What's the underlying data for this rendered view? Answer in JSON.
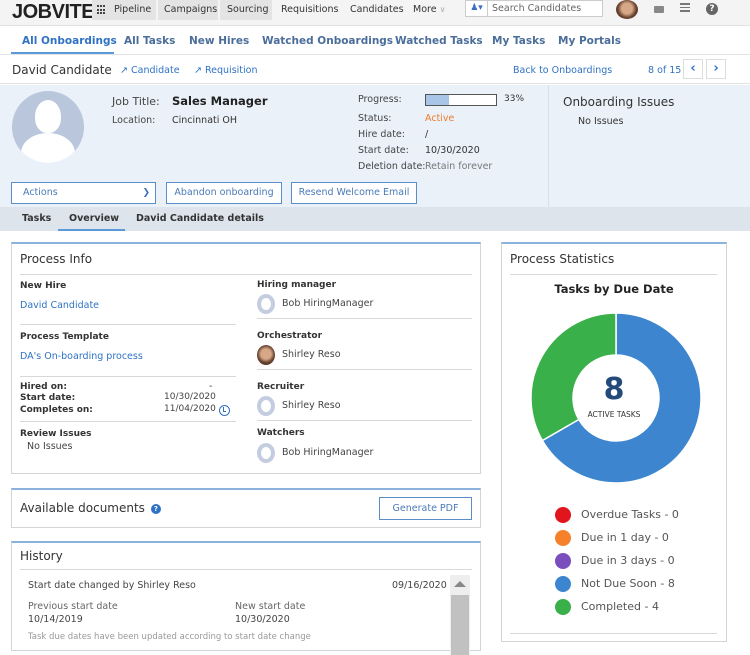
{
  "topbar": {
    "logo": "JOBVITE",
    "nav": [
      "Pipeline",
      "Campaigns",
      "Sourcing",
      "Requisitions",
      "Candidates",
      "More"
    ],
    "search_placeholder": "Search Candidates"
  },
  "subnav": {
    "items": [
      "All Onboardings",
      "All Tasks",
      "New Hires",
      "Watched Onboardings",
      "Watched Tasks",
      "My Tasks",
      "My Portals"
    ],
    "active": "All Onboardings"
  },
  "candidate_bar": {
    "name": "David Candidate",
    "candidate_link": "Candidate",
    "requisition_link": "Requisition",
    "back_link": "Back to Onboardings",
    "pager": "8 of 15"
  },
  "hero": {
    "job_title_label": "Job Title:",
    "job_title": "Sales Manager",
    "location_label": "Location:",
    "location": "Cincinnati OH",
    "progress_label": "Progress:",
    "progress_percent": 33,
    "progress_text": "33%",
    "status_label": "Status:",
    "status": "Active",
    "hire_date_label": "Hire date:",
    "hire_date": "/",
    "start_date_label": "Start date:",
    "start_date": "10/30/2020",
    "deletion_date_label": "Deletion date:",
    "deletion_date": "Retain forever",
    "issues_title": "Onboarding Issues",
    "issues_value": "No Issues",
    "actions_label": "Actions",
    "abandon_label": "Abandon onboarding",
    "resend_label": "Resend Welcome Email"
  },
  "tabs": {
    "items": [
      "Tasks",
      "Overview",
      "David Candidate details"
    ],
    "active": "Overview"
  },
  "process_info": {
    "title": "Process Info",
    "new_hire_label": "New Hire",
    "new_hire": "David Candidate",
    "template_label": "Process Template",
    "template": "DA's On-boarding process",
    "hired_on_label": "Hired on:",
    "hired_on": "-",
    "start_date_label": "Start date:",
    "start_date": "10/30/2020",
    "completes_on_label": "Completes on:",
    "completes_on": "11/04/2020",
    "review_issues_label": "Review Issues",
    "review_issues": "No Issues",
    "hiring_manager_label": "Hiring manager",
    "hiring_manager": "Bob HiringManager",
    "orchestrator_label": "Orchestrator",
    "orchestrator": "Shirley Reso",
    "recruiter_label": "Recruiter",
    "recruiter": "Shirley Reso",
    "watchers_label": "Watchers",
    "watchers": "Bob HiringManager"
  },
  "documents": {
    "title": "Available documents",
    "generate_label": "Generate PDF"
  },
  "history": {
    "title": "History",
    "entries": [
      {
        "summary": "Start date changed by Shirley Reso",
        "date": "09/16/2020",
        "previous_label": "Previous start date",
        "previous_value": "10/14/2019",
        "new_label": "New start date",
        "new_value": "10/30/2020",
        "note": "Task due dates have been updated according to start date change"
      }
    ]
  },
  "stats": {
    "title": "Process Statistics",
    "center_number": "8",
    "center_label": "ACTIVE TASKS"
  },
  "chart_data": {
    "type": "pie",
    "title": "Tasks by Due Date",
    "categories": [
      "Overdue Tasks",
      "Due in 1 day",
      "Due in 3 days",
      "Not Due Soon",
      "Completed"
    ],
    "values": [
      0,
      0,
      0,
      8,
      4
    ],
    "colors": [
      "#e3151c",
      "#f5822a",
      "#7a4fbd",
      "#3d86cf",
      "#39b04a"
    ],
    "legend_labels": [
      "Overdue Tasks - 0",
      "Due in 1 day - 0",
      "Due in 3 days - 0",
      "Not Due Soon - 8",
      "Completed - 4"
    ],
    "legend_position": "bottom"
  }
}
